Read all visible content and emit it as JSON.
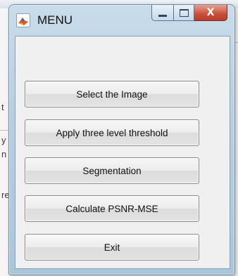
{
  "window": {
    "title": "MENU",
    "close_glyph": "X",
    "icon": "matlab-figure-icon"
  },
  "background": {
    "letters": [
      "t",
      "y",
      "n",
      "re"
    ]
  },
  "buttons": [
    {
      "label": "Select the Image"
    },
    {
      "label": "Apply three level threshold"
    },
    {
      "label": "Segmentation"
    },
    {
      "label": "Calculate PSNR-MSE"
    },
    {
      "label": "Exit"
    }
  ]
}
